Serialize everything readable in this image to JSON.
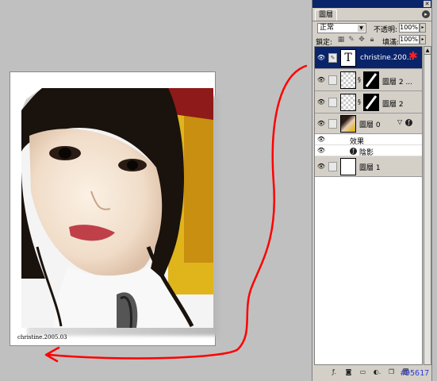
{
  "canvas": {
    "caption": "christine.2005.03"
  },
  "panel": {
    "tab": "圖層",
    "blend_mode": "正常",
    "opacity_label": "不透明:",
    "opacity_value": "100%",
    "lock_label": "鎖定:",
    "fill_label": "填滿:",
    "fill_value": "100%",
    "layers": [
      {
        "name": "christine.200...",
        "kind": "text",
        "thumb_glyph": "T",
        "selected": true
      },
      {
        "name": "圖層 2 ...",
        "kind": "masked"
      },
      {
        "name": "圖層 2",
        "kind": "masked"
      },
      {
        "name": "圖層 0",
        "kind": "photo",
        "effects_label": "效果",
        "effect": "陰影"
      },
      {
        "name": "圖層 1",
        "kind": "plain"
      }
    ],
    "colors": {
      "titlebar": "#0a246a",
      "selection": "#0a246a",
      "panel_bg": "#d4d0c8",
      "arrow": "#ff0000"
    }
  },
  "watermark": "#95617"
}
